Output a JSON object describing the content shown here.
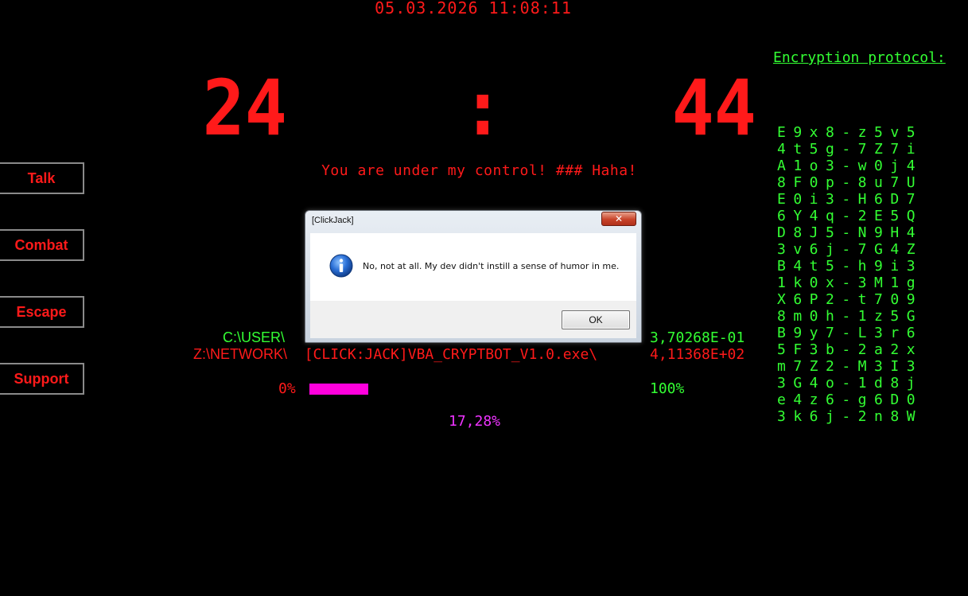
{
  "datetime": "05.03.2026 11:08:11",
  "timer": {
    "hours": "24",
    "separator": ":",
    "minutes": "44"
  },
  "taunt": "You are under my control! ### Haha!",
  "side_buttons": [
    {
      "label": "Talk"
    },
    {
      "label": "Combat"
    },
    {
      "label": "Escape"
    },
    {
      "label": "Support"
    }
  ],
  "encryption": {
    "title": "Encryption protocol:",
    "rows": [
      "E9x8-z5v5",
      "4t5g-7Z7i",
      "A1o3-w0j4",
      "8F0p-8u7U",
      "E0i3-H6D7",
      "6Y4q-2E5Q",
      "D8J5-N9H4",
      "3v6j-7G4Z",
      "B4t5-h9i3",
      "1k0x-3M1g",
      "X6P2-t709",
      "8m0h-1z5G",
      "B9y7-L3r6",
      "5F3b-2a2x",
      "m7Z2-M3I3",
      "3G4o-1d8j",
      "e4z6-g6D0",
      "3k6j-2n8W"
    ]
  },
  "paths": {
    "user_path": "C:\\USER\\",
    "user_value": "3,70268E-01",
    "network_path": "Z:\\NETWORK\\",
    "network_file": "[CLICK:JACK]VBA_CRYPTBOT_V1.0.exe\\",
    "network_value": "4,11368E+02"
  },
  "progress": {
    "start_label": "0%",
    "end_label": "100%",
    "current_label": "17,28%",
    "value": 0.1728,
    "fill_color": "#ff00dd"
  },
  "dialog": {
    "title": "[ClickJack]",
    "close_glyph": "✕",
    "message": "No, not at all. My dev didn't instill a sense of humor in me.",
    "ok_label": "OK",
    "icon": "info-icon"
  },
  "colors": {
    "red": "#ff1a1a",
    "green": "#33ff33",
    "magenta": "#ff00dd",
    "background": "#000000"
  }
}
